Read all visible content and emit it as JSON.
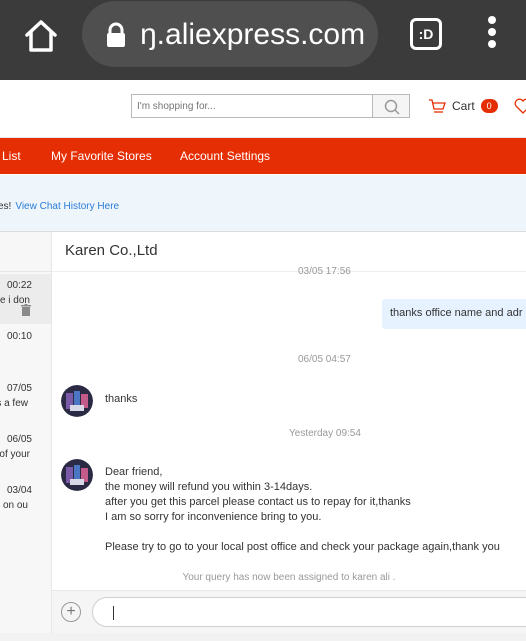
{
  "browser": {
    "url_text": "ŋ.aliexpress.com",
    "tab_switcher_label": ":D",
    "icons": {
      "home": "home-icon",
      "lock": "lock-icon",
      "menu": "more-vert-icon"
    }
  },
  "header": {
    "search_placeholder": "I'm shopping for...",
    "cart_label": "Cart",
    "cart_count": "0",
    "accent": "#e62e04"
  },
  "nav": {
    "items": [
      {
        "label": "List"
      },
      {
        "label": "My Favorite Stores"
      },
      {
        "label": "Account Settings"
      }
    ]
  },
  "notice": {
    "text": "es!",
    "link": "View Chat History Here"
  },
  "conversations": [
    {
      "time": "00:22",
      "snippet": "e i don"
    },
    {
      "time": "00:10",
      "snippet": ""
    },
    {
      "time": "07/05",
      "snippet": "s a few"
    },
    {
      "time": "06/05",
      "snippet": "of your"
    },
    {
      "time": "03/04",
      "snippet": "g on ou"
    }
  ],
  "chat": {
    "title": "Karen Co.,Ltd",
    "top_stamp": "03/05 17:56",
    "my_message": "thanks office name and adr",
    "stamp_1": "06/05 04:57",
    "msg_1": "thanks",
    "stamp_2": "Yesterday 09:54",
    "msg_2_lines": [
      "Dear friend,",
      "the money will refund you within 3-14days.",
      "after you get this parcel please contact us to repay for it,thanks",
      "I am so sorry for inconvenience bring to you.",
      "",
      "Please try to go to your local post office and check your package again,thank you"
    ],
    "system_note": "Your query has now been assigned to karen ali ."
  },
  "composer": {
    "plus_label": "+"
  }
}
